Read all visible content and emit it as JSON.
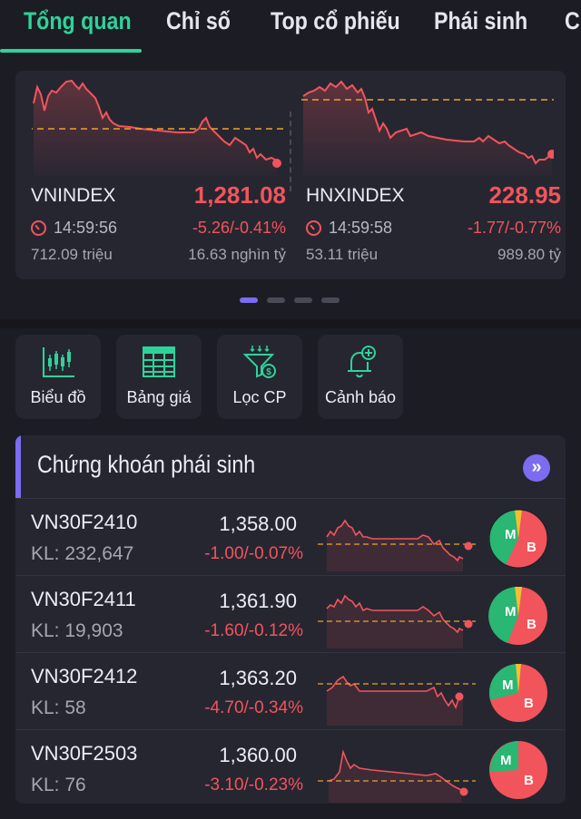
{
  "tabs": [
    "Tổng quan",
    "Chỉ số",
    "Top cổ phiếu",
    "Phái sinh",
    "Chứng quyền"
  ],
  "indices": [
    {
      "name": "VNINDEX",
      "value": "1,281.08",
      "time": "14:59:56",
      "change": "-5.26/-0.41%",
      "volume": "712.09 triệu",
      "trade_value": "16.63 nghìn tỷ"
    },
    {
      "name": "HNXINDEX",
      "value": "228.95",
      "time": "14:59:58",
      "change": "-1.77/-0.77%",
      "volume": "53.11 triệu",
      "trade_value": "989.80 tỷ"
    }
  ],
  "quick_actions": [
    {
      "label": "Biểu đồ",
      "icon": "candlestick-chart-icon"
    },
    {
      "label": "Bảng giá",
      "icon": "price-board-icon"
    },
    {
      "label": "Lọc CP",
      "icon": "stock-filter-icon"
    },
    {
      "label": "Cảnh báo",
      "icon": "bell-add-icon"
    }
  ],
  "derivatives": {
    "title": "Chứng khoán phái sinh",
    "more_icon": "double-chevron-right-icon",
    "rows": [
      {
        "symbol": "VN30F2410",
        "volume": "KL: 232,647",
        "price": "1,358.00",
        "change": "-1.00/-0.07%",
        "buy_share": 0.42
      },
      {
        "symbol": "VN30F2411",
        "volume": "KL: 19,903",
        "price": "1,361.90",
        "change": "-1.60/-0.12%",
        "buy_share": 0.43
      },
      {
        "symbol": "VN30F2412",
        "volume": "KL: 58",
        "price": "1,363.20",
        "change": "-4.70/-0.34%",
        "buy_share": 0.38
      },
      {
        "symbol": "VN30F2503",
        "volume": "KL: 76",
        "price": "1,360.00",
        "change": "-3.10/-0.23%",
        "buy_share": 0.22
      }
    ],
    "pie_labels": {
      "buy": "M",
      "sell": "B"
    }
  },
  "colors": {
    "accent": "#2ed39a",
    "down": "#f2545b",
    "purple": "#7b6cf0",
    "ref_line": "#f0a030"
  }
}
